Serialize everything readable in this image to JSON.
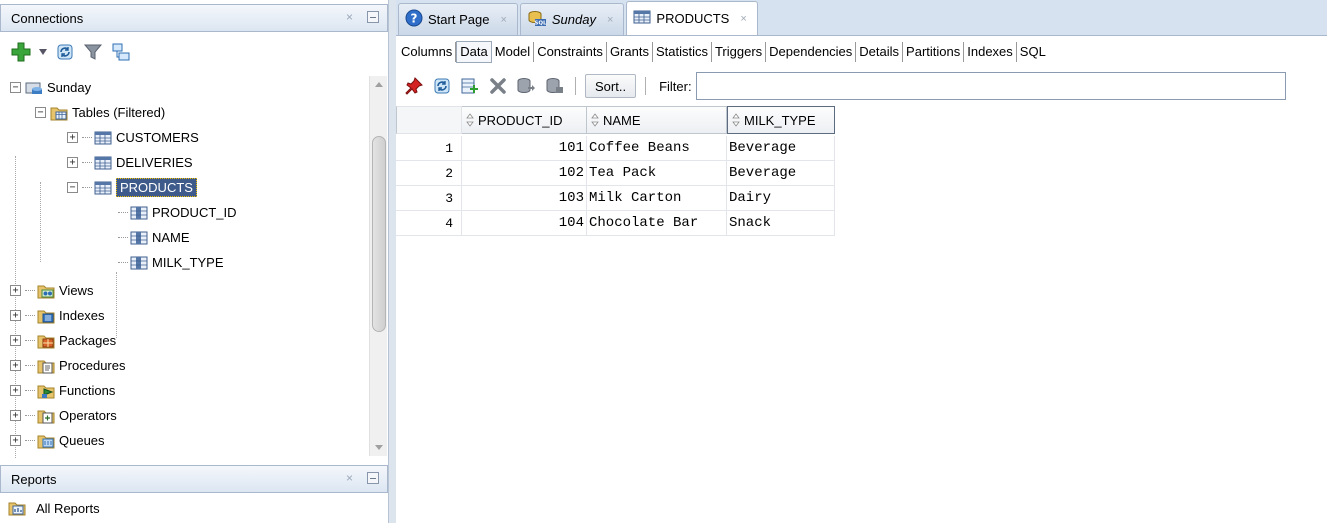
{
  "connections_panel": {
    "title": "Connections",
    "close_glyph": "×",
    "toolbar_icons": [
      "add-connection-icon",
      "dropdown-arrow-icon",
      "refresh-icon",
      "filter-icon",
      "schema-browser-icon"
    ]
  },
  "tree": {
    "connection": "Sunday",
    "tables_folder": "Tables (Filtered)",
    "tables": [
      "CUSTOMERS",
      "DELIVERIES",
      "PRODUCTS"
    ],
    "columns": [
      "PRODUCT_ID",
      "NAME",
      "MILK_TYPE"
    ],
    "folders": [
      "Views",
      "Indexes",
      "Packages",
      "Procedures",
      "Functions",
      "Operators",
      "Queues"
    ],
    "expand_glyph": "+",
    "collapse_glyph": "−"
  },
  "reports_panel": {
    "title": "Reports",
    "close_glyph": "×",
    "item": "All Reports"
  },
  "editor_tabs": [
    {
      "label": "Start Page",
      "icon": "help-icon"
    },
    {
      "label": "Sunday",
      "icon": "sql-worksheet-icon"
    },
    {
      "label": "PRODUCTS",
      "icon": "table-icon"
    }
  ],
  "tab_close_glyph": "×",
  "sub_tabs": [
    "Columns",
    "Data",
    "Model",
    "Constraints",
    "Grants",
    "Statistics",
    "Triggers",
    "Dependencies",
    "Details",
    "Partitions",
    "Indexes",
    "SQL"
  ],
  "active_sub_tab": "Data",
  "data_toolbar": {
    "sort_label": "Sort..",
    "filter_label": "Filter:",
    "filter_value": "",
    "icons": [
      "freeze-pin-icon",
      "refresh-icon",
      "insert-row-icon",
      "delete-row-icon",
      "commit-icon",
      "rollback-icon"
    ]
  },
  "grid": {
    "columns": [
      "PRODUCT_ID",
      "NAME",
      "MILK_TYPE"
    ],
    "rows": [
      {
        "num": "1",
        "product_id": "101",
        "name": "Coffee Beans",
        "milk_type": "Beverage"
      },
      {
        "num": "2",
        "product_id": "102",
        "name": "Tea Pack",
        "milk_type": "Beverage"
      },
      {
        "num": "3",
        "product_id": "103",
        "name": "Milk Carton",
        "milk_type": "Dairy"
      },
      {
        "num": "4",
        "product_id": "104",
        "name": "Chocolate Bar",
        "milk_type": "Snack"
      }
    ]
  }
}
